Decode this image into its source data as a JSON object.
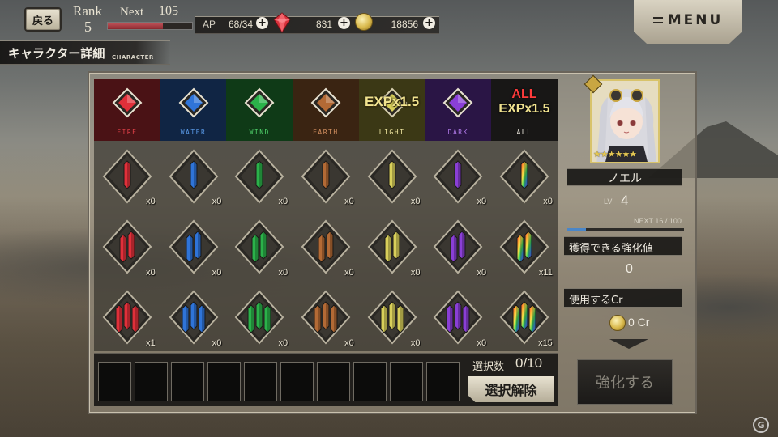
{
  "header": {
    "back_label": "戻る",
    "rank_label": "Rank",
    "rank_value": "5",
    "next_label": "Next",
    "next_value": "105",
    "rank_progress": 0.65,
    "ap_label": "AP",
    "ap_value": "68/34",
    "gem_value": "831",
    "coin_value": "18856",
    "plus": "+",
    "page_title": "キャラクター詳細",
    "page_title_en": "CHARACTER",
    "menu_label": "MENU"
  },
  "elements": [
    {
      "key": "fire",
      "name": "FIRE",
      "color": "#e0303a",
      "name_color": "#e04048",
      "bg": "#4a1215"
    },
    {
      "key": "water",
      "name": "WATER",
      "color": "#2f74d8",
      "name_color": "#5a9ae8",
      "bg": "#102544"
    },
    {
      "key": "wind",
      "name": "WIND",
      "color": "#2bb24a",
      "name_color": "#4fd06a",
      "bg": "#0f3a17"
    },
    {
      "key": "earth",
      "name": "EARTH",
      "color": "#b36a35",
      "name_color": "#d49060",
      "bg": "#3a2412"
    },
    {
      "key": "light",
      "name": "LIGHT",
      "color": "#d8cf5a",
      "name_color": "#efe6a0",
      "bg": "#3b3815",
      "bonus": "EXPx1.5"
    },
    {
      "key": "dark",
      "name": "DARK",
      "color": "#8a3fd6",
      "name_color": "#b07ae8",
      "bg": "#2a1545"
    },
    {
      "key": "all",
      "name": "ALL",
      "color": "#ff3b3b",
      "name_color": "#f0ece2",
      "bg": "#181716",
      "bonus_top": "ALL",
      "bonus_bottom": "EXPx1.5"
    }
  ],
  "crystals": {
    "rows": [
      {
        "size": "small",
        "counts": [
          "x0",
          "x0",
          "x0",
          "x0",
          "x0",
          "x0",
          "x0"
        ]
      },
      {
        "size": "medium",
        "counts": [
          "x0",
          "x0",
          "x0",
          "x0",
          "x0",
          "x0",
          "x11"
        ]
      },
      {
        "size": "large",
        "counts": [
          "x1",
          "x0",
          "x0",
          "x0",
          "x0",
          "x0",
          "x15"
        ]
      }
    ]
  },
  "selection": {
    "label": "選択数",
    "value": "0/10",
    "slot_count": 10,
    "deselect_label": "選択解除"
  },
  "character": {
    "name": "ノエル",
    "stars": "★★★★★★",
    "level_label": "LV",
    "level_value": "4",
    "next_exp": "NEXT 16 / 100",
    "exp_progress": 0.16,
    "gain_label": "獲得できる強化値",
    "gain_value": "0",
    "use_label": "使用するCr",
    "cr_value": "0 Cr",
    "enhance_label": "強化する"
  },
  "watermark": "G"
}
